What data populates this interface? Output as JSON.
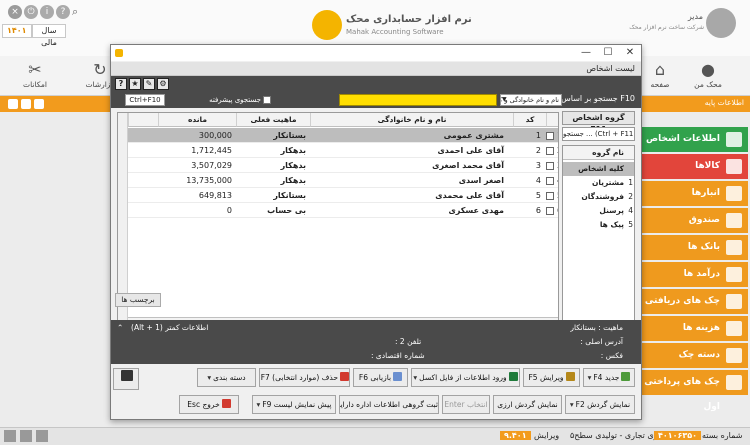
{
  "background": {
    "fiscal_year_label": "سال مالی",
    "fiscal_year_value": "۱۴۰۱",
    "logo_title": "نرم افزار حسابداری محک",
    "logo_subtitle": "Mahak Accounting Software",
    "user_name": "مدیر",
    "user_subtitle": "شرکت ساخت نرم افزار محک",
    "toolbar": [
      "امکانات",
      "گزارشات",
      "صفحه",
      "محک من"
    ],
    "orange_bar_label": "اطلاعات پایه",
    "side_menu": [
      {
        "label": "اطلاعات اشخاص",
        "active": true
      },
      {
        "label": "کالاها",
        "red": true
      },
      {
        "label": "انبارها"
      },
      {
        "label": "صندوق"
      },
      {
        "label": "بانک ها"
      },
      {
        "label": "درآمد ها"
      },
      {
        "label": "چک های دریافتی اول"
      },
      {
        "label": "هزینه ها"
      },
      {
        "label": "دسته چک"
      },
      {
        "label": "چک های پرداختی اول"
      }
    ],
    "status": {
      "build_label": "شماره بسته",
      "build_value": "۴۰۱۰۶۳۵۰",
      "version_label": "ویرایش",
      "version_value": "۹.۴۰۱",
      "series": "سری تجاری - تولیدی سطح۵"
    },
    "colors": {
      "orange": "#f29b1d",
      "green": "#31a24c",
      "red": "#e2453b",
      "yellow": "#ffde00",
      "dark": "#4a4a4a"
    }
  },
  "dialog": {
    "title": "لیست اشخاص",
    "iconbar": [
      "gear-icon",
      "tools-icon",
      "star-icon",
      "help-icon"
    ],
    "help_glyph": "?",
    "search": {
      "label": "F10 جستجو بر اساس :",
      "field_value": "نام و نام خانوادگی و کد",
      "advanced_label": "جستجوی پیشرفته",
      "shortcut_label": "Ctrl+F10"
    },
    "columns": {
      "code": "کد",
      "name": "نام و نام خانوادگی",
      "nature": "ماهیت فعلی",
      "balance": "مانده"
    },
    "rows": [
      {
        "num": "1",
        "code": "1",
        "name": "مشتری عمومی",
        "nature": "بستانکار",
        "balance": "300,000",
        "selected": true
      },
      {
        "num": "2",
        "code": "2",
        "name": "آقای علی احمدی",
        "nature": "بدهکار",
        "balance": "1,712,445"
      },
      {
        "num": "3",
        "code": "3",
        "name": "آقای محمد اصغری",
        "nature": "بدهکار",
        "balance": "3,507,029"
      },
      {
        "num": "4",
        "code": "4",
        "name": "اصغر اسدی",
        "nature": "بدهکار",
        "balance": "13,735,000"
      },
      {
        "num": "5",
        "code": "5",
        "name": "آقای علی محمدی",
        "nature": "بستانکار",
        "balance": "649,813"
      },
      {
        "num": "6",
        "code": "6",
        "name": "مهدی عسکری",
        "nature": "بی حساب",
        "balance": "0"
      }
    ],
    "row_count": "6",
    "labels_button": "برچسب ها",
    "groups": {
      "title": "گروه اشخاص F11",
      "search_placeholder": "جستجو ... (Ctrl + F11)",
      "header": "نام گروه",
      "items": [
        {
          "num": "",
          "label": "کلیه اشخاص",
          "selected": true
        },
        {
          "num": "1",
          "label": "مشتریان"
        },
        {
          "num": "2",
          "label": "فروشندگان"
        },
        {
          "num": "4",
          "label": "پرسنل"
        },
        {
          "num": "5",
          "label": "پیک ها"
        }
      ],
      "count": "5"
    },
    "details": {
      "nature": "ماهیت : بستانکار",
      "more_info": "اطلاعات کمتر (Alt + 1)",
      "address": "آدرس اصلی :",
      "phone": "تلفن 2 :",
      "fax": "فکس :",
      "economic_code": "شماره اقتصادی :"
    },
    "buttons_row1": {
      "new": "جدید F4",
      "edit": "ویرایش F5",
      "import": "ورود اطلاعات از فایل اکسل",
      "refresh": "بازیابی F6",
      "delete": "حذف (موارد انتخابی) F7",
      "categorize": "دسته بندی"
    },
    "buttons_row2": {
      "show_turnover_f2": "نمایش گردش F2",
      "show_turnover_currency": "نمایش گردش ارزی",
      "select_enter": "انتخاب Enter",
      "group_register": "ثبت گروهی اطلاعات اداره دارایی",
      "print_preview": "پیش نمایش لیست F9",
      "exit": "خروج Esc"
    }
  }
}
